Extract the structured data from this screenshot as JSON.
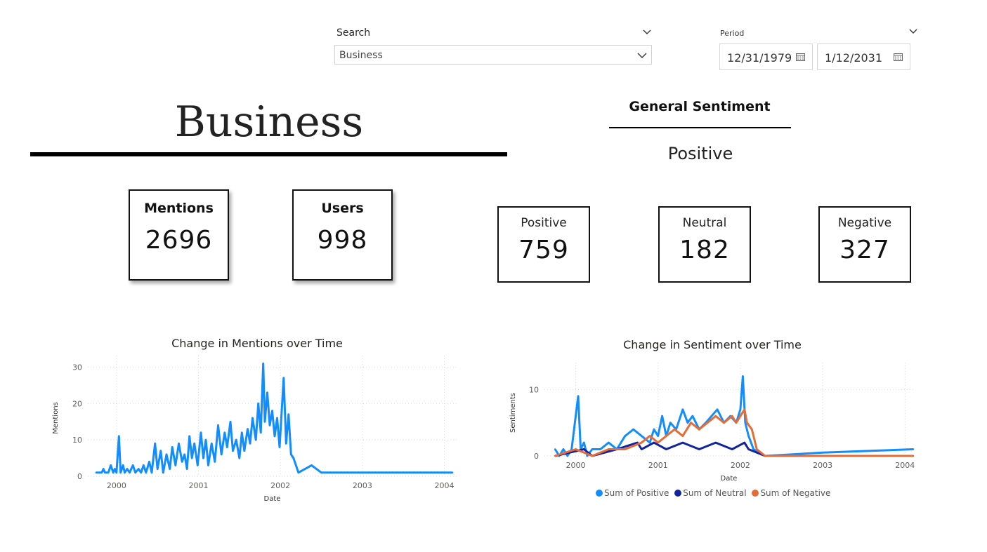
{
  "filters": {
    "search": {
      "label": "Search",
      "value": "Business"
    },
    "period": {
      "label": "Period",
      "start": "12/31/1979",
      "end": "1/12/2031"
    }
  },
  "topic": {
    "title": "Business"
  },
  "general_sentiment": {
    "title": "General Sentiment",
    "value": "Positive"
  },
  "kpis": {
    "mentions": {
      "label": "Mentions",
      "value": "2696"
    },
    "users": {
      "label": "Users",
      "value": "998"
    },
    "positive": {
      "label": "Positive",
      "value": "759"
    },
    "neutral": {
      "label": "Neutral",
      "value": "182"
    },
    "negative": {
      "label": "Negative",
      "value": "327"
    }
  },
  "colors": {
    "positive": "#118DFF",
    "neutral": "#12239E",
    "negative": "#E66C37"
  },
  "chart_data": [
    {
      "type": "line",
      "title": "Change in Mentions over Time",
      "xlabel": "Date",
      "ylabel": "Mentions",
      "x_ticks": [
        "2000",
        "2001",
        "2002",
        "2003",
        "2004"
      ],
      "y_ticks": [
        0,
        10,
        20,
        30
      ],
      "ylim": [
        0,
        32
      ],
      "grid": true,
      "series": [
        {
          "values": [
            [
              1999.75,
              1
            ],
            [
              1999.82,
              1
            ],
            [
              1999.84,
              2
            ],
            [
              1999.86,
              1
            ],
            [
              1999.9,
              1
            ],
            [
              1999.93,
              3
            ],
            [
              1999.96,
              1
            ],
            [
              1999.98,
              2
            ],
            [
              2000.0,
              1
            ],
            [
              2000.03,
              11
            ],
            [
              2000.05,
              1
            ],
            [
              2000.08,
              3
            ],
            [
              2000.1,
              1
            ],
            [
              2000.13,
              2
            ],
            [
              2000.16,
              1
            ],
            [
              2000.2,
              3
            ],
            [
              2000.23,
              1
            ],
            [
              2000.27,
              2
            ],
            [
              2000.3,
              1
            ],
            [
              2000.33,
              3
            ],
            [
              2000.36,
              1
            ],
            [
              2000.4,
              4
            ],
            [
              2000.43,
              1
            ],
            [
              2000.47,
              9
            ],
            [
              2000.5,
              2
            ],
            [
              2000.54,
              7
            ],
            [
              2000.57,
              1
            ],
            [
              2000.61,
              6
            ],
            [
              2000.65,
              2
            ],
            [
              2000.68,
              8
            ],
            [
              2000.72,
              3
            ],
            [
              2000.76,
              9
            ],
            [
              2000.8,
              4
            ],
            [
              2000.83,
              6
            ],
            [
              2000.86,
              2
            ],
            [
              2000.89,
              11
            ],
            [
              2000.92,
              5
            ],
            [
              2000.95,
              9
            ],
            [
              2000.99,
              3
            ],
            [
              2001.03,
              12
            ],
            [
              2001.06,
              5
            ],
            [
              2001.09,
              10
            ],
            [
              2001.12,
              3
            ],
            [
              2001.16,
              9
            ],
            [
              2001.2,
              4
            ],
            [
              2001.24,
              14
            ],
            [
              2001.28,
              6
            ],
            [
              2001.32,
              12
            ],
            [
              2001.35,
              8
            ],
            [
              2001.39,
              15
            ],
            [
              2001.42,
              7
            ],
            [
              2001.46,
              10
            ],
            [
              2001.5,
              5
            ],
            [
              2001.53,
              12
            ],
            [
              2001.56,
              7
            ],
            [
              2001.6,
              13
            ],
            [
              2001.63,
              9
            ],
            [
              2001.66,
              16
            ],
            [
              2001.7,
              10
            ],
            [
              2001.73,
              20
            ],
            [
              2001.76,
              12
            ],
            [
              2001.79,
              31
            ],
            [
              2001.81,
              15
            ],
            [
              2001.84,
              23
            ],
            [
              2001.87,
              14
            ],
            [
              2001.9,
              18
            ],
            [
              2001.93,
              11
            ],
            [
              2001.96,
              16
            ],
            [
              2001.99,
              8
            ],
            [
              2002.04,
              27
            ],
            [
              2002.07,
              9
            ],
            [
              2002.1,
              17
            ],
            [
              2002.13,
              6
            ],
            [
              2002.16,
              5
            ],
            [
              2002.19,
              3
            ],
            [
              2002.22,
              1
            ],
            [
              2002.38,
              3
            ],
            [
              2002.5,
              1
            ],
            [
              2003.0,
              1
            ],
            [
              2004.1,
              1
            ]
          ]
        }
      ]
    },
    {
      "type": "line",
      "title": "Change in Sentiment over Time",
      "xlabel": "Date",
      "ylabel": "Sentiments",
      "x_ticks": [
        "2000",
        "2001",
        "2002",
        "2003",
        "2004"
      ],
      "y_ticks": [
        0,
        10
      ],
      "ylim": [
        0,
        13
      ],
      "grid": true,
      "legend": "bottom",
      "series": [
        {
          "name": "Sum of Positive",
          "values": [
            [
              1999.75,
              1
            ],
            [
              1999.8,
              0
            ],
            [
              1999.85,
              1
            ],
            [
              1999.9,
              0
            ],
            [
              1999.95,
              1
            ],
            [
              2000.03,
              9
            ],
            [
              2000.06,
              1
            ],
            [
              2000.1,
              2
            ],
            [
              2000.14,
              0
            ],
            [
              2000.2,
              1
            ],
            [
              2000.3,
              1
            ],
            [
              2000.4,
              2
            ],
            [
              2000.5,
              1
            ],
            [
              2000.6,
              3
            ],
            [
              2000.7,
              4
            ],
            [
              2000.8,
              3
            ],
            [
              2000.9,
              2
            ],
            [
              2000.95,
              4
            ],
            [
              2001.0,
              3
            ],
            [
              2001.05,
              6
            ],
            [
              2001.1,
              3
            ],
            [
              2001.15,
              5
            ],
            [
              2001.22,
              4
            ],
            [
              2001.3,
              7
            ],
            [
              2001.36,
              5
            ],
            [
              2001.42,
              6
            ],
            [
              2001.5,
              4
            ],
            [
              2001.58,
              5
            ],
            [
              2001.65,
              6
            ],
            [
              2001.72,
              7
            ],
            [
              2001.8,
              5
            ],
            [
              2001.88,
              6
            ],
            [
              2001.95,
              5
            ],
            [
              2002.0,
              7
            ],
            [
              2002.03,
              12
            ],
            [
              2002.06,
              5
            ],
            [
              2002.1,
              3
            ],
            [
              2002.16,
              1
            ],
            [
              2002.3,
              0
            ],
            [
              2003.0,
              0.5
            ],
            [
              2004.1,
              1
            ]
          ]
        },
        {
          "name": "Sum of Neutral",
          "values": [
            [
              1999.75,
              0
            ],
            [
              2000.1,
              1
            ],
            [
              2000.2,
              0
            ],
            [
              2000.5,
              1
            ],
            [
              2000.75,
              2
            ],
            [
              2000.8,
              1
            ],
            [
              2000.95,
              2
            ],
            [
              2001.1,
              1
            ],
            [
              2001.3,
              2
            ],
            [
              2001.5,
              1
            ],
            [
              2001.7,
              2
            ],
            [
              2001.9,
              1
            ],
            [
              2002.05,
              2
            ],
            [
              2002.1,
              1
            ],
            [
              2002.3,
              0
            ],
            [
              2003.0,
              0
            ],
            [
              2004.1,
              0
            ]
          ]
        },
        {
          "name": "Sum of Negative",
          "values": [
            [
              1999.75,
              0
            ],
            [
              2000.0,
              1
            ],
            [
              2000.2,
              0
            ],
            [
              2000.4,
              1
            ],
            [
              2000.6,
              1
            ],
            [
              2000.8,
              2
            ],
            [
              2000.9,
              3
            ],
            [
              2001.0,
              2
            ],
            [
              2001.1,
              3
            ],
            [
              2001.2,
              4
            ],
            [
              2001.3,
              3
            ],
            [
              2001.4,
              5
            ],
            [
              2001.5,
              4
            ],
            [
              2001.6,
              5
            ],
            [
              2001.7,
              6
            ],
            [
              2001.8,
              5
            ],
            [
              2001.9,
              6
            ],
            [
              2001.95,
              5
            ],
            [
              2002.0,
              6
            ],
            [
              2002.05,
              7
            ],
            [
              2002.08,
              5
            ],
            [
              2002.14,
              4
            ],
            [
              2002.2,
              1
            ],
            [
              2002.3,
              0
            ],
            [
              2003.0,
              0
            ],
            [
              2004.1,
              0
            ]
          ]
        }
      ]
    }
  ]
}
